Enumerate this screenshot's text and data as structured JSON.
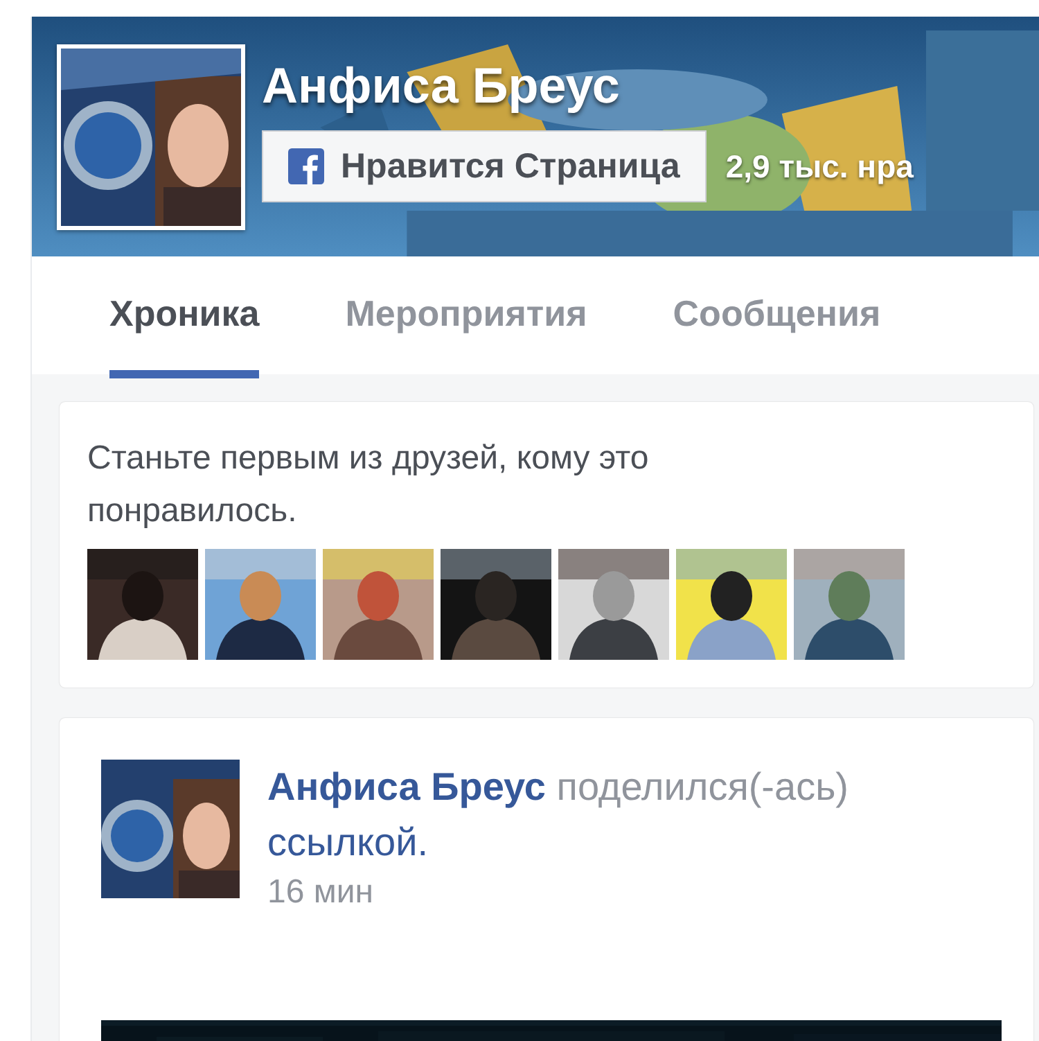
{
  "page": {
    "name": "Анфиса Бреус",
    "like_button": "Нравится Страница",
    "likes_count": "2,9 тыс. нра"
  },
  "tabs": [
    {
      "label": "Хроника",
      "selected": true
    },
    {
      "label": "Мероприятия",
      "selected": false
    },
    {
      "label": "Сообщения",
      "selected": false
    }
  ],
  "friends_card": {
    "text": "Станьте первым из друзей, кому это понравилось."
  },
  "post": {
    "author": "Анфиса Бреус",
    "action": "поделился(-ась)",
    "link": "ссылкой.",
    "time": "16 мин"
  }
}
